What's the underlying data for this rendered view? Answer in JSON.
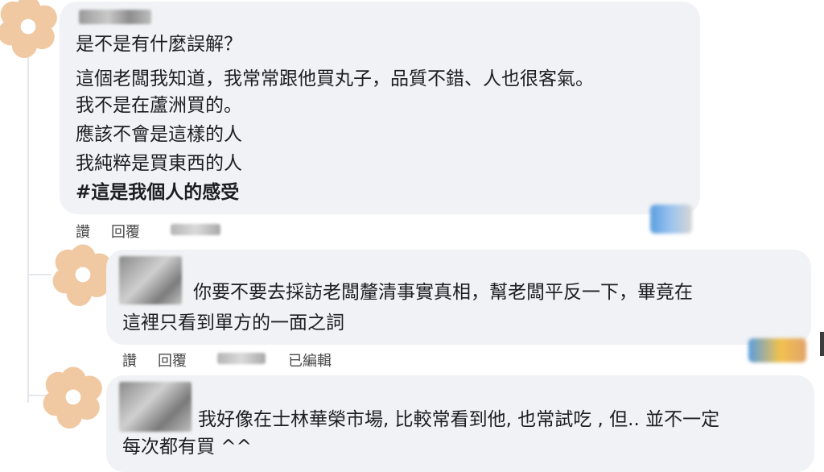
{
  "comments": [
    {
      "lines": [
        "是不是有什麼誤解？",
        "這個老闆我知道，我常常跟他買丸子，品質不錯、人也很客氣。",
        "我不是在蘆洲買的。",
        "應該不會是這樣的人",
        "我純粹是買東西的人",
        "#這是我個人的感受"
      ],
      "actions": {
        "like": "讚",
        "reply": "回覆"
      }
    },
    {
      "lines": [
        "你要不要去採訪老闆釐清事實真相，幫老闆平反一下，畢竟在",
        "這裡只看到單方的一面之詞"
      ],
      "actions": {
        "like": "讚",
        "reply": "回覆",
        "edited": "已編輯"
      }
    },
    {
      "lines": [
        "我好像在士林華榮市場, 比較常看到他, 也常試吃 , 但.. 並不一定",
        "每次都有買 ^^"
      ]
    }
  ],
  "colors": {
    "bubble": "#f0f2f5",
    "avatar_petal": "#f0c9a2",
    "avatar_center": "#ffffff",
    "text": "#1c1e21"
  },
  "icons": [
    "flower-avatar-icon"
  ]
}
